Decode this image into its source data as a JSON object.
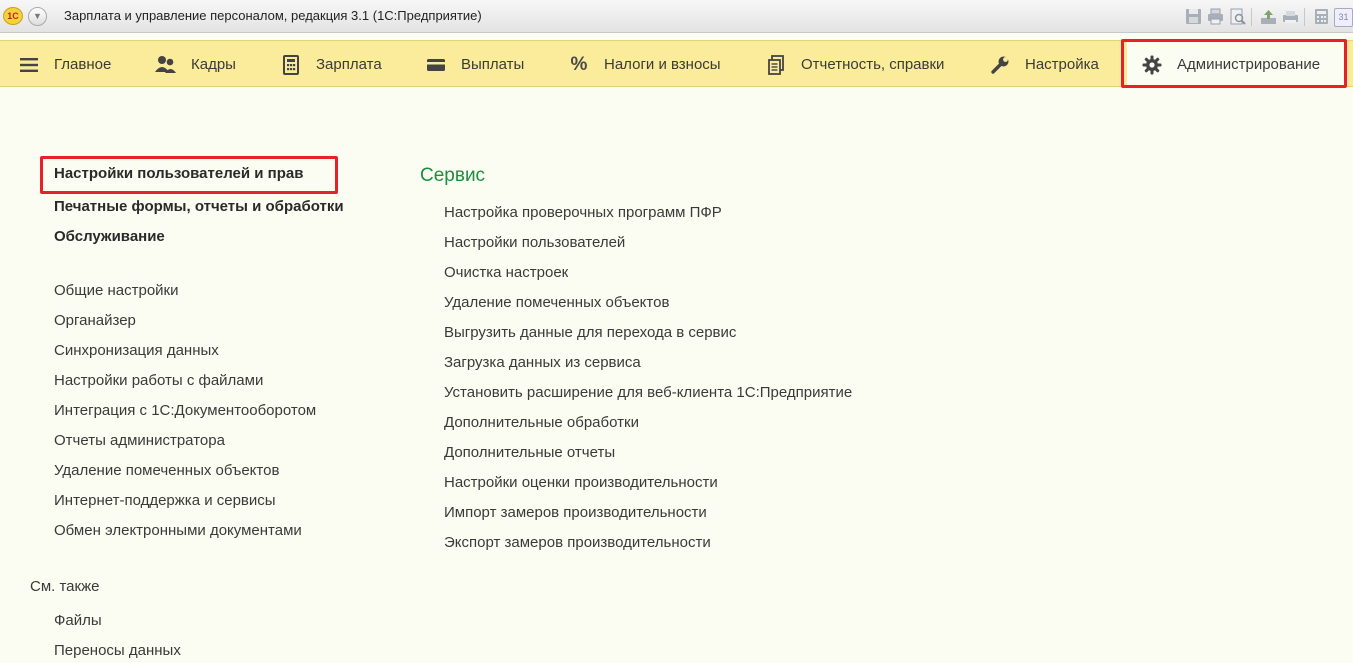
{
  "window": {
    "title": "Зарплата и управление персоналом, редакция 3.1  (1С:Предприятие)",
    "logo": "1С",
    "toolbar_icons": [
      "save-icon",
      "print-icon",
      "preview-icon",
      "upload-icon",
      "printer-icon",
      "calculator-icon",
      "calendar-icon"
    ],
    "calendar_day": "31"
  },
  "sections": [
    {
      "label": "Главное",
      "icon": "menu-lines-icon",
      "active": false
    },
    {
      "label": "Кадры",
      "icon": "people-icon",
      "active": false
    },
    {
      "label": "Зарплата",
      "icon": "calculator-icon",
      "active": false
    },
    {
      "label": "Выплаты",
      "icon": "wallet-icon",
      "active": false
    },
    {
      "label": "Налоги и взносы",
      "icon": "percent-icon",
      "active": false
    },
    {
      "label": "Отчетность, справки",
      "icon": "documents-icon",
      "active": false
    },
    {
      "label": "Настройка",
      "icon": "wrench-icon",
      "active": false
    },
    {
      "label": "Администрирование",
      "icon": "gear-icon",
      "active": true
    }
  ],
  "left_nav": {
    "bold_items": [
      "Настройки пользователей и прав",
      "Печатные формы, отчеты и обработки",
      "Обслуживание"
    ],
    "items": [
      "Общие настройки",
      "Органайзер",
      "Синхронизация данных",
      "Настройки работы с файлами",
      "Интеграция с 1С:Документооборотом",
      "Отчеты администратора",
      "Удаление помеченных объектов",
      "Интернет-поддержка и сервисы",
      "Обмен электронными документами"
    ],
    "see_also_label": "См. также",
    "see_also_items": [
      "Файлы",
      "Переносы данных"
    ]
  },
  "service": {
    "title": "Сервис",
    "items": [
      "Настройка проверочных программ ПФР",
      "Настройки пользователей",
      "Очистка настроек",
      "Удаление помеченных объектов",
      "Выгрузить данные для перехода в сервис",
      "Загрузка данных из сервиса",
      "Установить расширение для веб-клиента 1С:Предприятие",
      "Дополнительные обработки",
      "Дополнительные отчеты",
      "Настройки оценки производительности",
      "Импорт замеров производительности",
      "Экспорт замеров производительности"
    ]
  },
  "colors": {
    "section_bar": "#fbec9b",
    "content_bg": "#fcfdf2",
    "highlight": "#e8202a",
    "group_title": "#1b8f3c"
  }
}
